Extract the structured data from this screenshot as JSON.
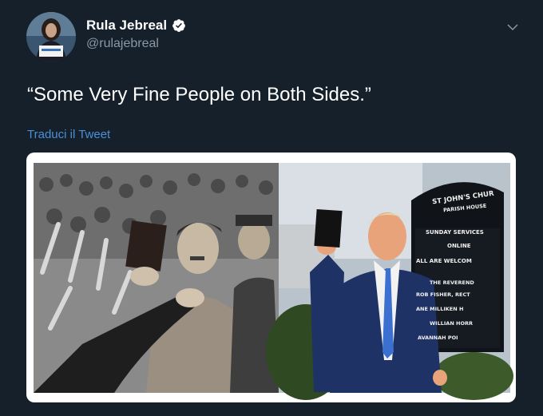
{
  "tweet": {
    "display_name": "Rula Jebreal",
    "handle": "@rulajebreal",
    "text": "“Some Very Fine People on Both Sides.”",
    "translate_link": "Traduci il Tweet",
    "verified": true
  },
  "media": {
    "sign_lines": [
      "ST JOHN'S CHUR",
      "PARISH HOUSE",
      "SUNDAY SERVICES",
      "ONLINE",
      "ALL ARE WELCOM",
      "THE REVEREND",
      "ROB FISHER, RECT",
      "ANE MILLIKEN H",
      "WILLIAN HORR",
      "AVANNAH POI"
    ]
  },
  "colors": {
    "background": "#15202b",
    "secondary_text": "#8899a6",
    "link": "#4a90d9",
    "verified": "#ffffff"
  },
  "icons": {
    "verified": "verified-badge-icon",
    "caret": "chevron-down-icon"
  }
}
